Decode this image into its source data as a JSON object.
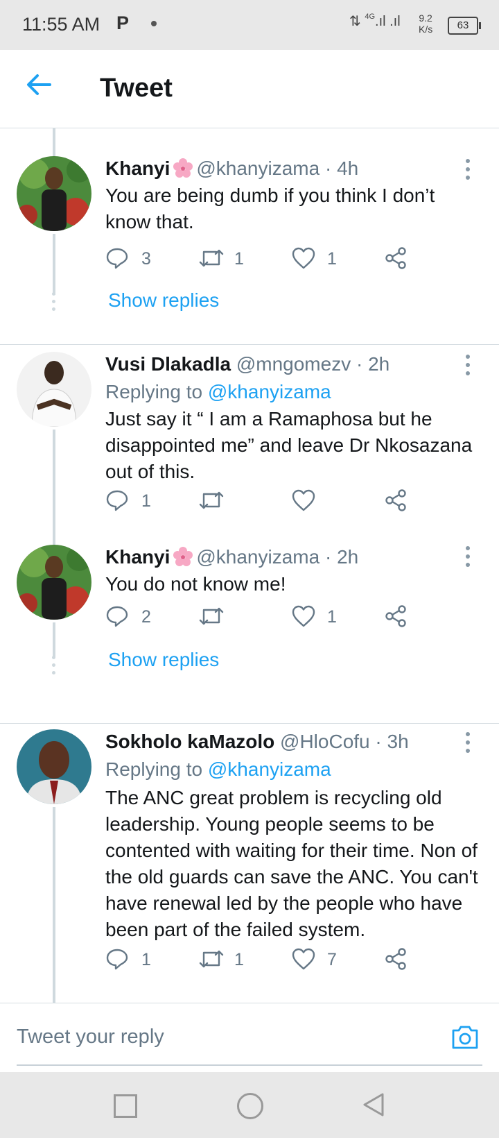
{
  "status_bar": {
    "time": "11:55 AM",
    "carrier_icon": "P",
    "network_type": "4G",
    "speed_value": "9.2",
    "speed_unit": "K/s",
    "battery": "63"
  },
  "header": {
    "title": "Tweet",
    "back_icon": "arrow-left-icon"
  },
  "colors": {
    "accent": "#1da1f2",
    "secondary_text": "#657786",
    "thread_line": "#cfd9de"
  },
  "tweets": [
    {
      "name": "Khanyi",
      "has_flower_emoji": true,
      "handle_time": "@khanyizama · 4h",
      "replying_to": null,
      "text": "You are being dumb if you think I don’t know that.",
      "replies": "3",
      "retweets": "1",
      "likes": "1",
      "show_replies": "Show replies"
    },
    {
      "name": "Vusi Dlakadla",
      "handle_time": "@mngomezv · 2h",
      "replying_prefix": "Replying to",
      "replying_to": "@khanyizama",
      "text": "Just say it “ I am a Ramaphosa but he disappointed me” and leave Dr Nkosazana out of this.",
      "replies": "1",
      "retweets": "",
      "likes": ""
    },
    {
      "name": "Khanyi",
      "has_flower_emoji": true,
      "handle_time": "@khanyizama · 2h",
      "text": "You do not know me!",
      "replies": "2",
      "retweets": "",
      "likes": "1",
      "show_replies": "Show replies"
    },
    {
      "name": "Sokholo kaMazolo",
      "handle_time": "@HloCofu · 3h",
      "replying_prefix": "Replying to",
      "replying_to": "@khanyizama",
      "text": "The ANC great problem is recycling old leadership. Young people seems to be contented with waiting for their time. Non of the old guards can save the ANC. You can't have renewal led by the people who have been part of the failed system.",
      "replies": "1",
      "retweets": "1",
      "likes": "7"
    }
  ],
  "reply_bar": {
    "placeholder": "Tweet your reply",
    "camera_icon": "camera-icon"
  },
  "nav_bar": {
    "icons": [
      "recents-square-icon",
      "home-circle-icon",
      "back-triangle-icon"
    ]
  }
}
